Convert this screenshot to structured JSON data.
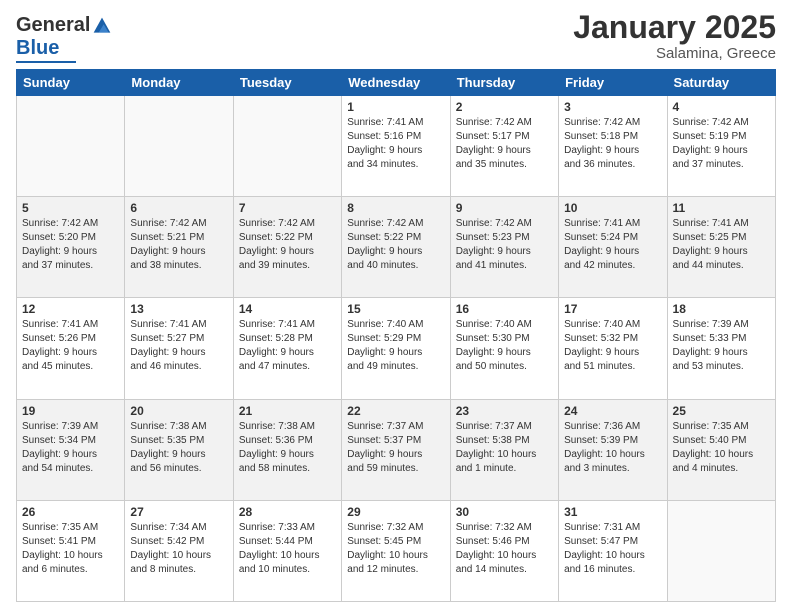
{
  "header": {
    "logo_general": "General",
    "logo_blue": "Blue",
    "month_title": "January 2025",
    "location": "Salamina, Greece"
  },
  "weekdays": [
    "Sunday",
    "Monday",
    "Tuesday",
    "Wednesday",
    "Thursday",
    "Friday",
    "Saturday"
  ],
  "weeks": [
    [
      {
        "day": "",
        "info": ""
      },
      {
        "day": "",
        "info": ""
      },
      {
        "day": "",
        "info": ""
      },
      {
        "day": "1",
        "info": "Sunrise: 7:41 AM\nSunset: 5:16 PM\nDaylight: 9 hours\nand 34 minutes."
      },
      {
        "day": "2",
        "info": "Sunrise: 7:42 AM\nSunset: 5:17 PM\nDaylight: 9 hours\nand 35 minutes."
      },
      {
        "day": "3",
        "info": "Sunrise: 7:42 AM\nSunset: 5:18 PM\nDaylight: 9 hours\nand 36 minutes."
      },
      {
        "day": "4",
        "info": "Sunrise: 7:42 AM\nSunset: 5:19 PM\nDaylight: 9 hours\nand 37 minutes."
      }
    ],
    [
      {
        "day": "5",
        "info": "Sunrise: 7:42 AM\nSunset: 5:20 PM\nDaylight: 9 hours\nand 37 minutes."
      },
      {
        "day": "6",
        "info": "Sunrise: 7:42 AM\nSunset: 5:21 PM\nDaylight: 9 hours\nand 38 minutes."
      },
      {
        "day": "7",
        "info": "Sunrise: 7:42 AM\nSunset: 5:22 PM\nDaylight: 9 hours\nand 39 minutes."
      },
      {
        "day": "8",
        "info": "Sunrise: 7:42 AM\nSunset: 5:22 PM\nDaylight: 9 hours\nand 40 minutes."
      },
      {
        "day": "9",
        "info": "Sunrise: 7:42 AM\nSunset: 5:23 PM\nDaylight: 9 hours\nand 41 minutes."
      },
      {
        "day": "10",
        "info": "Sunrise: 7:41 AM\nSunset: 5:24 PM\nDaylight: 9 hours\nand 42 minutes."
      },
      {
        "day": "11",
        "info": "Sunrise: 7:41 AM\nSunset: 5:25 PM\nDaylight: 9 hours\nand 44 minutes."
      }
    ],
    [
      {
        "day": "12",
        "info": "Sunrise: 7:41 AM\nSunset: 5:26 PM\nDaylight: 9 hours\nand 45 minutes."
      },
      {
        "day": "13",
        "info": "Sunrise: 7:41 AM\nSunset: 5:27 PM\nDaylight: 9 hours\nand 46 minutes."
      },
      {
        "day": "14",
        "info": "Sunrise: 7:41 AM\nSunset: 5:28 PM\nDaylight: 9 hours\nand 47 minutes."
      },
      {
        "day": "15",
        "info": "Sunrise: 7:40 AM\nSunset: 5:29 PM\nDaylight: 9 hours\nand 49 minutes."
      },
      {
        "day": "16",
        "info": "Sunrise: 7:40 AM\nSunset: 5:30 PM\nDaylight: 9 hours\nand 50 minutes."
      },
      {
        "day": "17",
        "info": "Sunrise: 7:40 AM\nSunset: 5:32 PM\nDaylight: 9 hours\nand 51 minutes."
      },
      {
        "day": "18",
        "info": "Sunrise: 7:39 AM\nSunset: 5:33 PM\nDaylight: 9 hours\nand 53 minutes."
      }
    ],
    [
      {
        "day": "19",
        "info": "Sunrise: 7:39 AM\nSunset: 5:34 PM\nDaylight: 9 hours\nand 54 minutes."
      },
      {
        "day": "20",
        "info": "Sunrise: 7:38 AM\nSunset: 5:35 PM\nDaylight: 9 hours\nand 56 minutes."
      },
      {
        "day": "21",
        "info": "Sunrise: 7:38 AM\nSunset: 5:36 PM\nDaylight: 9 hours\nand 58 minutes."
      },
      {
        "day": "22",
        "info": "Sunrise: 7:37 AM\nSunset: 5:37 PM\nDaylight: 9 hours\nand 59 minutes."
      },
      {
        "day": "23",
        "info": "Sunrise: 7:37 AM\nSunset: 5:38 PM\nDaylight: 10 hours\nand 1 minute."
      },
      {
        "day": "24",
        "info": "Sunrise: 7:36 AM\nSunset: 5:39 PM\nDaylight: 10 hours\nand 3 minutes."
      },
      {
        "day": "25",
        "info": "Sunrise: 7:35 AM\nSunset: 5:40 PM\nDaylight: 10 hours\nand 4 minutes."
      }
    ],
    [
      {
        "day": "26",
        "info": "Sunrise: 7:35 AM\nSunset: 5:41 PM\nDaylight: 10 hours\nand 6 minutes."
      },
      {
        "day": "27",
        "info": "Sunrise: 7:34 AM\nSunset: 5:42 PM\nDaylight: 10 hours\nand 8 minutes."
      },
      {
        "day": "28",
        "info": "Sunrise: 7:33 AM\nSunset: 5:44 PM\nDaylight: 10 hours\nand 10 minutes."
      },
      {
        "day": "29",
        "info": "Sunrise: 7:32 AM\nSunset: 5:45 PM\nDaylight: 10 hours\nand 12 minutes."
      },
      {
        "day": "30",
        "info": "Sunrise: 7:32 AM\nSunset: 5:46 PM\nDaylight: 10 hours\nand 14 minutes."
      },
      {
        "day": "31",
        "info": "Sunrise: 7:31 AM\nSunset: 5:47 PM\nDaylight: 10 hours\nand 16 minutes."
      },
      {
        "day": "",
        "info": ""
      }
    ]
  ]
}
